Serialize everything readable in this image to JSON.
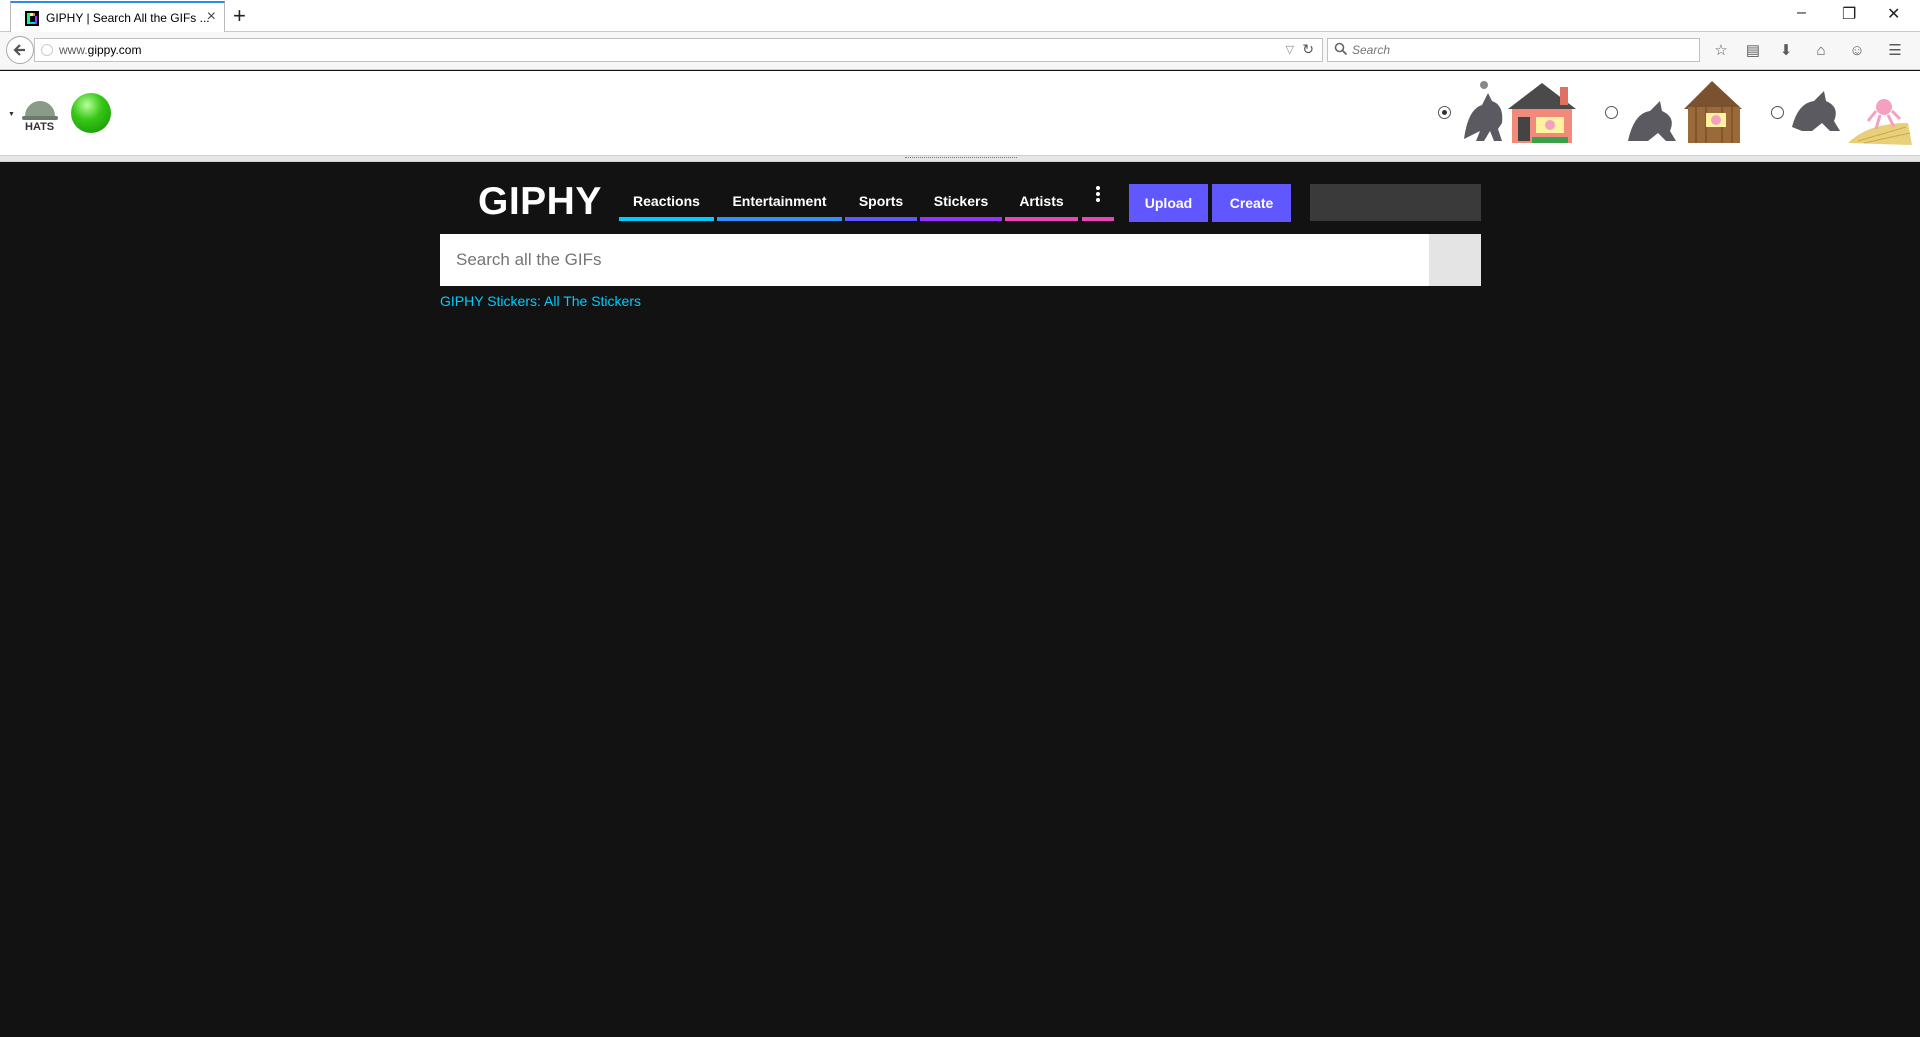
{
  "browser": {
    "tab_title": "GIPHY | Search All the GIFs ...",
    "new_tab": "+",
    "url_prefix": "www.",
    "url_domain": "gippy.com",
    "search_placeholder": "Search",
    "window_controls": [
      "–",
      "❐",
      "✕"
    ],
    "toolbar_icons": [
      "star-icon",
      "reading-list-icon",
      "download-icon",
      "home-icon",
      "chat-icon",
      "menu-icon"
    ]
  },
  "extensions": {
    "hats_label": "HATS",
    "story_choices": [
      {
        "selected": true,
        "icon": "wolf-brick-house"
      },
      {
        "selected": false,
        "icon": "wolf-wood-house"
      },
      {
        "selected": false,
        "icon": "wolf-straw-house"
      }
    ]
  },
  "giphy": {
    "logo": "GIPHY",
    "nav": [
      {
        "label": "Reactions",
        "color": "#00ccff"
      },
      {
        "label": "Entertainment",
        "color": "#3191ff"
      },
      {
        "label": "Sports",
        "color": "#6157ff"
      },
      {
        "label": "Stickers",
        "color": "#9933ff"
      },
      {
        "label": "Artists",
        "color": "#e646b6"
      }
    ],
    "more_color": "#e646b6",
    "upload_label": "Upload",
    "create_label": "Create",
    "accent": "#6157ff",
    "search_placeholder": "Search all the GIFs",
    "breadcrumb": "GIPHY Stickers: All The Stickers"
  }
}
